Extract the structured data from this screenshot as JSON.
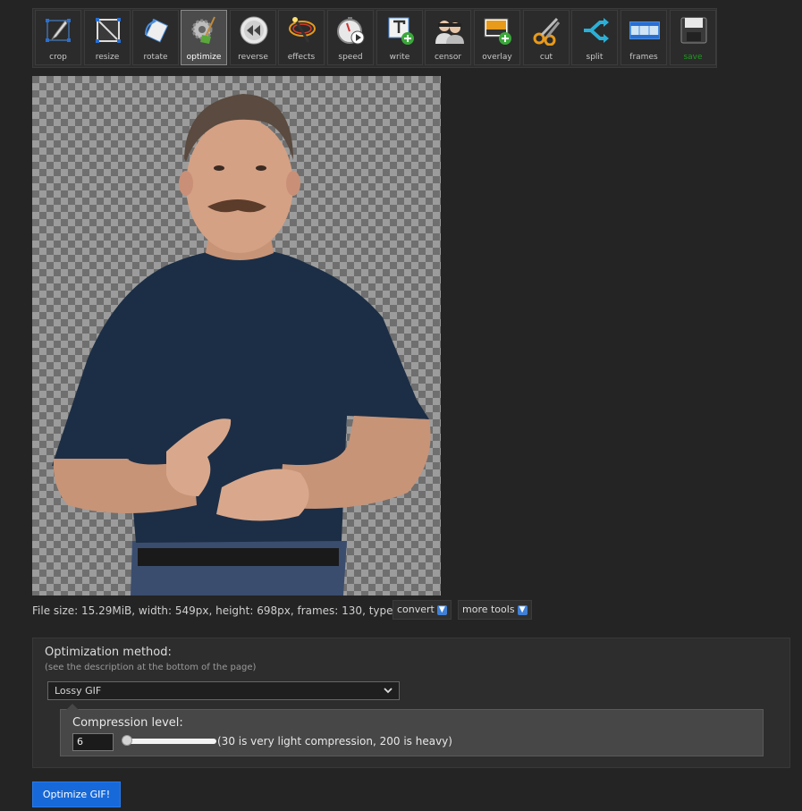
{
  "toolbar": {
    "tools": [
      {
        "label": "crop",
        "icon": "crop-icon"
      },
      {
        "label": "resize",
        "icon": "resize-icon"
      },
      {
        "label": "rotate",
        "icon": "rotate-icon"
      },
      {
        "label": "optimize",
        "icon": "broom-gear-icon",
        "active": true
      },
      {
        "label": "reverse",
        "icon": "rewind-icon"
      },
      {
        "label": "effects",
        "icon": "magic-wand-icon"
      },
      {
        "label": "speed",
        "icon": "stopwatch-icon"
      },
      {
        "label": "write",
        "icon": "text-add-icon"
      },
      {
        "label": "censor",
        "icon": "censor-icon"
      },
      {
        "label": "overlay",
        "icon": "image-add-icon"
      },
      {
        "label": "cut",
        "icon": "scissors-icon"
      },
      {
        "label": "split",
        "icon": "split-arrows-icon"
      },
      {
        "label": "frames",
        "icon": "film-strip-icon"
      },
      {
        "label": "save",
        "icon": "floppy-disk-icon"
      }
    ]
  },
  "file_info": {
    "text": "File size: 15.29MiB, width: 549px, height: 698px, frames: 130, type: gif",
    "convert_label": "convert",
    "more_tools_label": "more tools"
  },
  "optimization": {
    "title": "Optimization method:",
    "subtitle": "(see the description at the bottom of the page)",
    "method_value": "Lossy GIF",
    "compression_label": "Compression level:",
    "compression_value": "6",
    "compression_hint": "(30 is very light compression, 200 is heavy)",
    "submit_label": "Optimize GIF!"
  }
}
